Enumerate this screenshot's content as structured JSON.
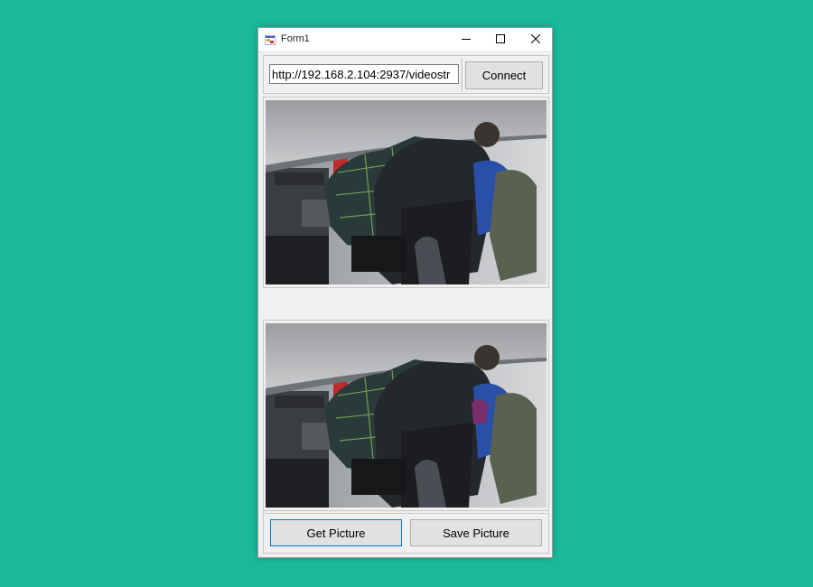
{
  "window": {
    "title": "Form1",
    "icon": "winforms-app-icon"
  },
  "titlebar_buttons": {
    "minimize": "minimize-icon",
    "maximize": "maximize-icon",
    "close": "close-icon"
  },
  "stream": {
    "url_value": "http://192.168.2.104:2937/videostr",
    "connect_label": "Connect"
  },
  "images": {
    "live_view": "live-camera-frame",
    "captured_view": "captured-picture"
  },
  "actions": {
    "get_picture_label": "Get Picture",
    "save_picture_label": "Save Picture"
  },
  "colors": {
    "desktop_background": "#1ab99a",
    "focus_border": "#0078d7"
  }
}
